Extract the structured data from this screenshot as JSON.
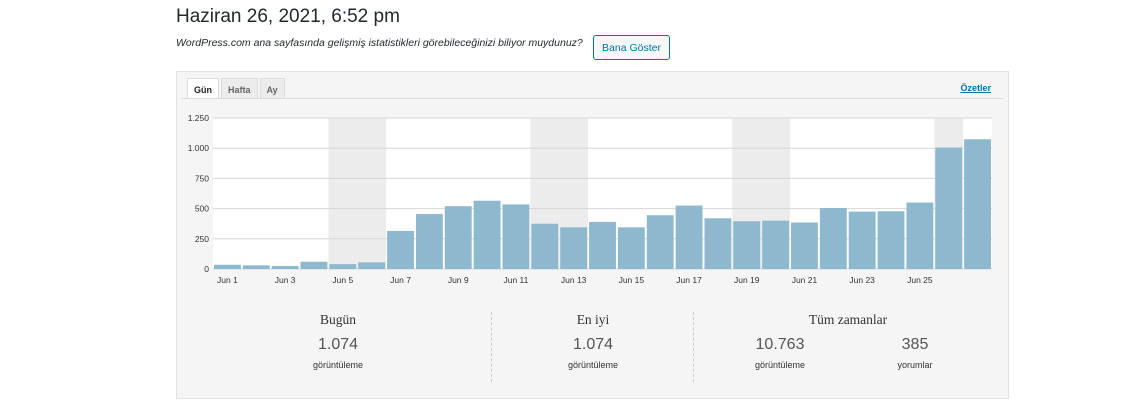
{
  "header": {
    "title": "Haziran 26, 2021, 6:52 pm",
    "promo_text": "WordPress.com ana sayfasında gelişmiş istatistikleri görebileceğinizi biliyor muydunuz?",
    "promo_button": "Bana Göster"
  },
  "tabs": [
    {
      "label": "Gün",
      "active": true
    },
    {
      "label": "Hafta",
      "active": false
    },
    {
      "label": "Ay",
      "active": false
    }
  ],
  "summary_link": "Özetler",
  "chart_data": {
    "type": "bar",
    "categories": [
      "Jun 1",
      "Jun 2",
      "Jun 3",
      "Jun 4",
      "Jun 5",
      "Jun 6",
      "Jun 7",
      "Jun 8",
      "Jun 9",
      "Jun 10",
      "Jun 11",
      "Jun 12",
      "Jun 13",
      "Jun 14",
      "Jun 15",
      "Jun 16",
      "Jun 17",
      "Jun 18",
      "Jun 19",
      "Jun 20",
      "Jun 21",
      "Jun 22",
      "Jun 23",
      "Jun 24",
      "Jun 25",
      "Jun 26"
    ],
    "tick_labels": [
      "Jun 1",
      "Jun 3",
      "Jun 5",
      "Jun 7",
      "Jun 9",
      "Jun 11",
      "Jun 13",
      "Jun 15",
      "Jun 17",
      "Jun 19",
      "Jun 21",
      "Jun 23",
      "Jun 25"
    ],
    "values": [
      35,
      30,
      25,
      60,
      40,
      55,
      315,
      455,
      520,
      565,
      535,
      375,
      345,
      390,
      345,
      445,
      525,
      420,
      395,
      400,
      385,
      505,
      475,
      478,
      550,
      1005,
      1074
    ],
    "weekend_categories": [
      "Jun 5",
      "Jun 6",
      "Jun 12",
      "Jun 13",
      "Jun 19",
      "Jun 20",
      "Jun 26"
    ],
    "yticks": [
      0,
      250,
      500,
      750,
      1000,
      1250
    ],
    "ytick_labels": [
      "0",
      "250",
      "500",
      "750",
      "1.000",
      "1.250"
    ],
    "ylim": [
      0,
      1250
    ],
    "bar_color": "#8db8ce",
    "weekend_color": "#ececec",
    "grid": true
  },
  "stats": {
    "today": {
      "title": "Bugün",
      "value": "1.074",
      "label": "görüntüleme"
    },
    "best": {
      "title": "En iyi",
      "value": "1.074",
      "label": "görüntüleme"
    },
    "all_time": {
      "title": "Tüm zamanlar",
      "views_value": "10.763",
      "views_label": "görüntüleme",
      "comments_value": "385",
      "comments_label": "yorumlar"
    }
  }
}
